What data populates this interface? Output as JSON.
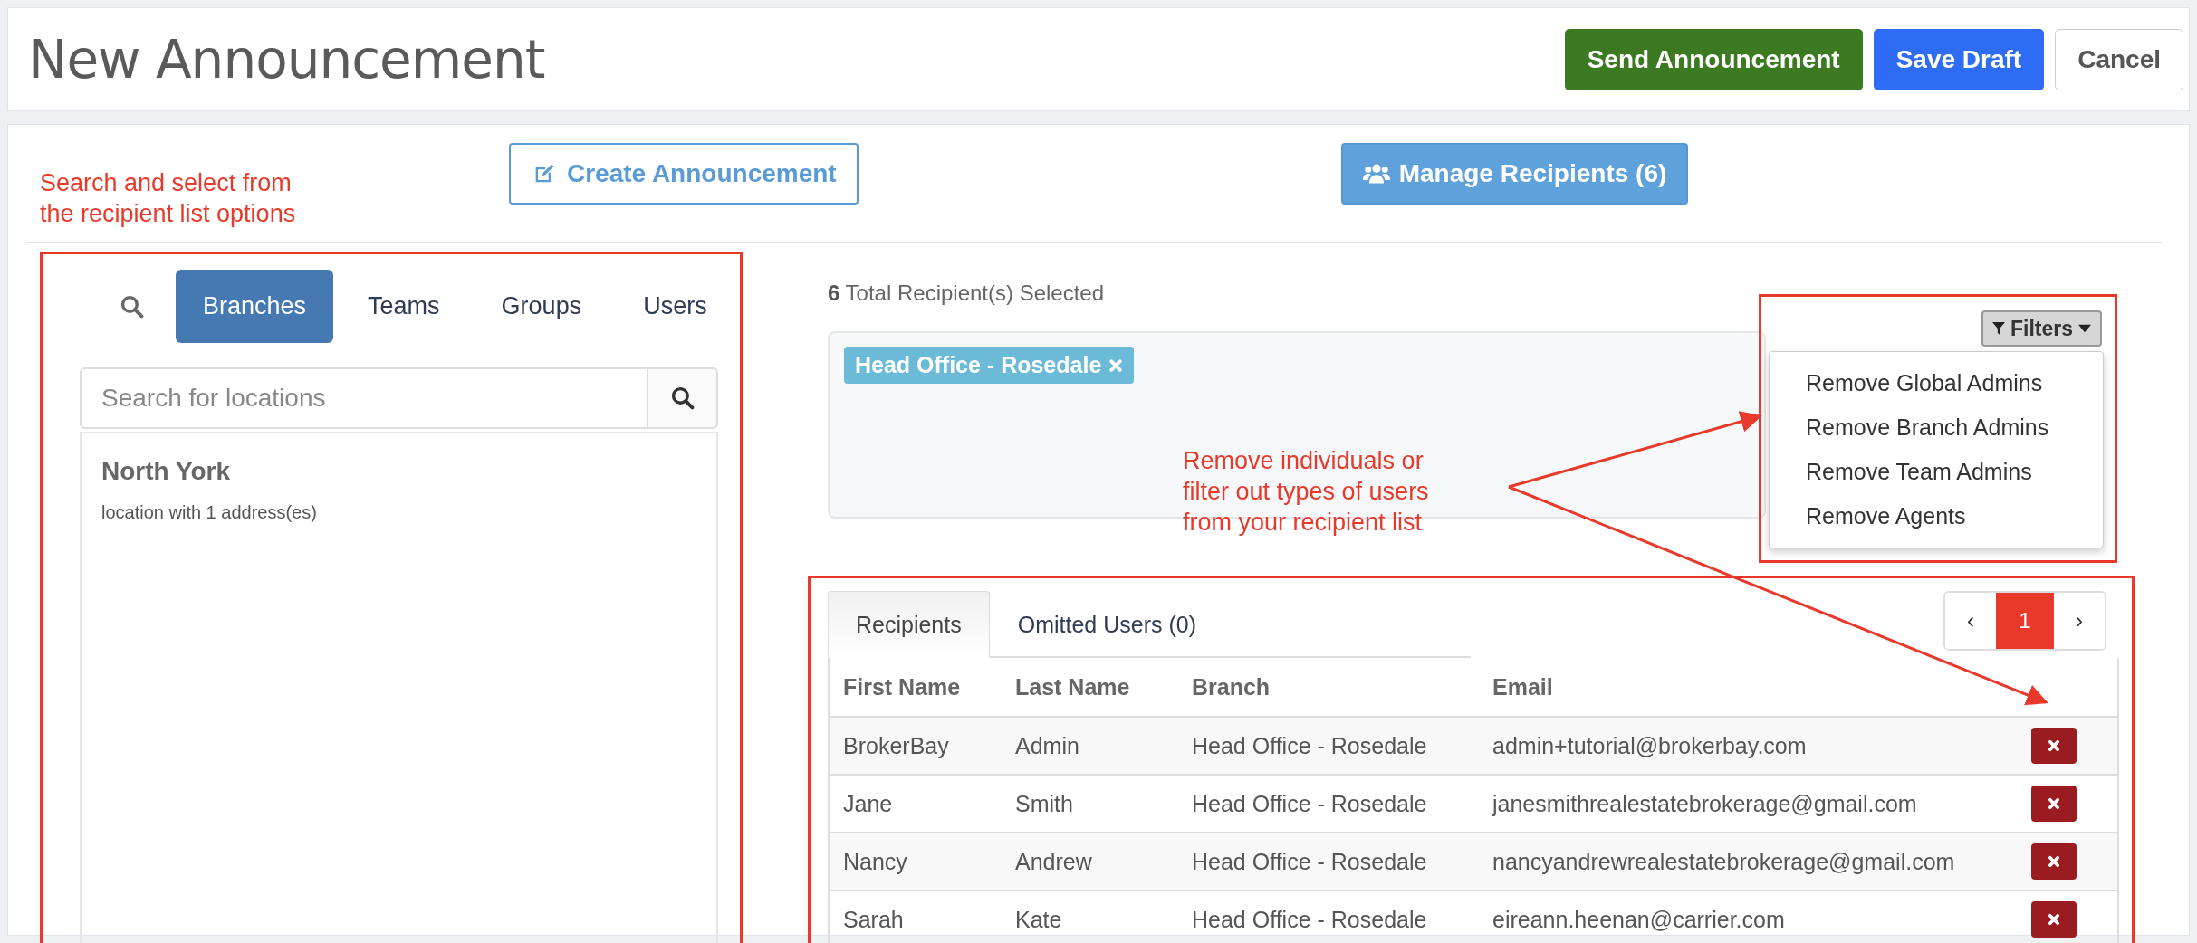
{
  "header": {
    "title": "New Announcement",
    "buttons": [
      {
        "label": "Send Announcement",
        "kind": "success"
      },
      {
        "label": "Save Draft",
        "kind": "primary"
      },
      {
        "label": "Cancel",
        "kind": "default"
      }
    ]
  },
  "steps": [
    {
      "label": "Create Announcement",
      "kind": "edit",
      "selected": false
    },
    {
      "label": "Manage Recipients (6)",
      "kind": "users",
      "selected": true
    }
  ],
  "annotations": [
    "Search and select from\nthe recipient list options",
    "Remove individuals or\nfilter out types of users\nfrom your recipient list"
  ],
  "source_panel": {
    "tabs": [
      {
        "label": "Branches",
        "selected": true
      },
      {
        "label": "Teams",
        "selected": false
      },
      {
        "label": "Groups",
        "selected": false
      },
      {
        "label": "Users",
        "selected": false
      }
    ],
    "search": {
      "placeholder": "Search for locations"
    },
    "items": [
      {
        "name": "North York",
        "detail": "location with 1 address(es)"
      }
    ]
  },
  "selection": {
    "count": "6",
    "label": "Total Recipient(s) Selected",
    "tags": [
      {
        "label": "Head Office - Rosedale"
      }
    ],
    "filters": {
      "label": "Filters",
      "expanded": true,
      "items": [
        "Remove Global Admins",
        "Remove Branch Admins",
        "Remove Team Admins",
        "Remove Agents"
      ]
    }
  },
  "recipients": {
    "tabs": [
      {
        "label": "Recipients",
        "selected": true
      },
      {
        "label": "Omitted Users (0)",
        "selected": false
      }
    ],
    "pagination": {
      "prev": "‹",
      "pages": [
        {
          "label": "1",
          "selected": true
        }
      ],
      "next": "›"
    },
    "columns": [
      "First Name",
      "Last Name",
      "Branch",
      "Email"
    ],
    "rows": [
      {
        "cells": [
          "BrokerBay",
          "Admin",
          "Head Office - Rosedale",
          "admin+tutorial@brokerbay.com"
        ]
      },
      {
        "cells": [
          "Jane",
          "Smith",
          "Head Office - Rosedale",
          "janesmithrealestatebrokerage@gmail.com"
        ]
      },
      {
        "cells": [
          "Nancy",
          "Andrew",
          "Head Office - Rosedale",
          "nancyandrewrealestatebrokerage@gmail.com"
        ]
      },
      {
        "cells": [
          "Sarah",
          "Kate",
          "Head Office - Rosedale",
          "eireann.heenan@carrier.com"
        ]
      }
    ]
  }
}
